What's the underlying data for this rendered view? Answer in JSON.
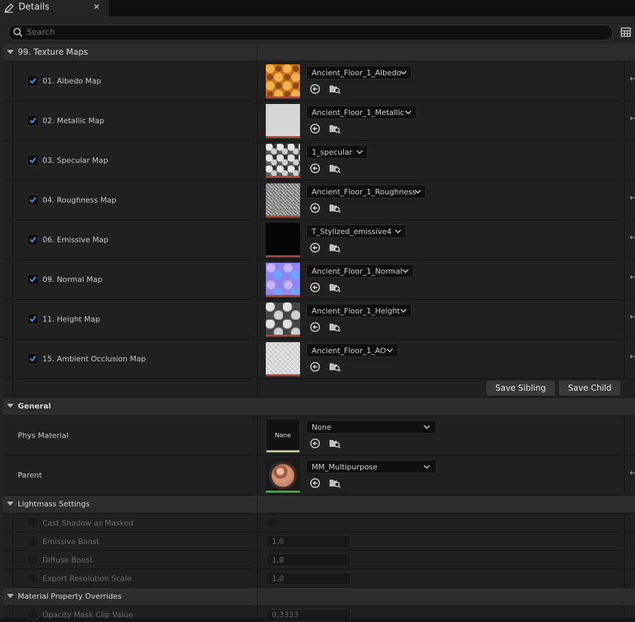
{
  "tab": {
    "title": "Details",
    "close_glyph": "✕",
    "icon": "pencil-icon"
  },
  "search": {
    "placeholder": "Search"
  },
  "sections": {
    "texture_maps": {
      "title": "99. Texture Maps",
      "items": [
        {
          "label": "01. Albedo Map",
          "asset": "Ancient_Floor_1_Albedo",
          "checked": true,
          "thumb": "albedo"
        },
        {
          "label": "02. Metallic Map",
          "asset": "Ancient_Floor_1_Metallic",
          "checked": true,
          "thumb": "metallic"
        },
        {
          "label": "03. Specular Map",
          "asset": "1_specular",
          "checked": true,
          "thumb": "specular"
        },
        {
          "label": "04. Roughness Map",
          "asset": "Ancient_Floor_1_Roughness",
          "checked": true,
          "thumb": "roughness"
        },
        {
          "label": "06. Emissive Map",
          "asset": "T_Stylized_emissive4",
          "checked": true,
          "thumb": "emissive"
        },
        {
          "label": "09. Normal Map",
          "asset": "Ancient_Floor_1_Normal",
          "checked": true,
          "thumb": "normal"
        },
        {
          "label": "11. Height Map",
          "asset": "Ancient_Floor_1_Height",
          "checked": true,
          "thumb": "height"
        },
        {
          "label": "15. Ambient Occlusion Map",
          "asset": "Ancient_Floor_1_AO",
          "checked": true,
          "thumb": "ao"
        }
      ],
      "save_sibling": "Save Sibling",
      "save_child": "Save Child"
    },
    "general": {
      "title": "General",
      "phys_material": {
        "label": "Phys Material",
        "value": "None",
        "thumb_text": "None"
      },
      "parent": {
        "label": "Parent",
        "value": "MM_Multipurpose"
      }
    },
    "lightmass": {
      "title": "Lightmass Settings",
      "cast_shadow": {
        "label": "Cast Shadow as Masked"
      },
      "emissive_boost": {
        "label": "Emissive Boost",
        "value": "1,0"
      },
      "diffuse_boost": {
        "label": "Diffuse Boost",
        "value": "1,0"
      },
      "export_resolution": {
        "label": "Export Resolution Scale",
        "value": "1,0"
      }
    },
    "overrides": {
      "title": "Material Property Overrides",
      "opacity_mask": {
        "label": "Opacity Mask Clip Value",
        "value": "0,3333"
      }
    }
  },
  "colors": {
    "accent_check": "#4a9ae8",
    "texture_bar": "#b3403c",
    "material_bar": "#3fa84a",
    "phys_bar": "#c8c29a"
  },
  "icons": {
    "use_selected": "use-selected-asset-icon",
    "browse": "browse-asset-icon",
    "reset": "reset-to-default-icon",
    "view_options": "table-view-icon",
    "search": "search-icon",
    "combo_arrow": "chevron-down-icon"
  }
}
